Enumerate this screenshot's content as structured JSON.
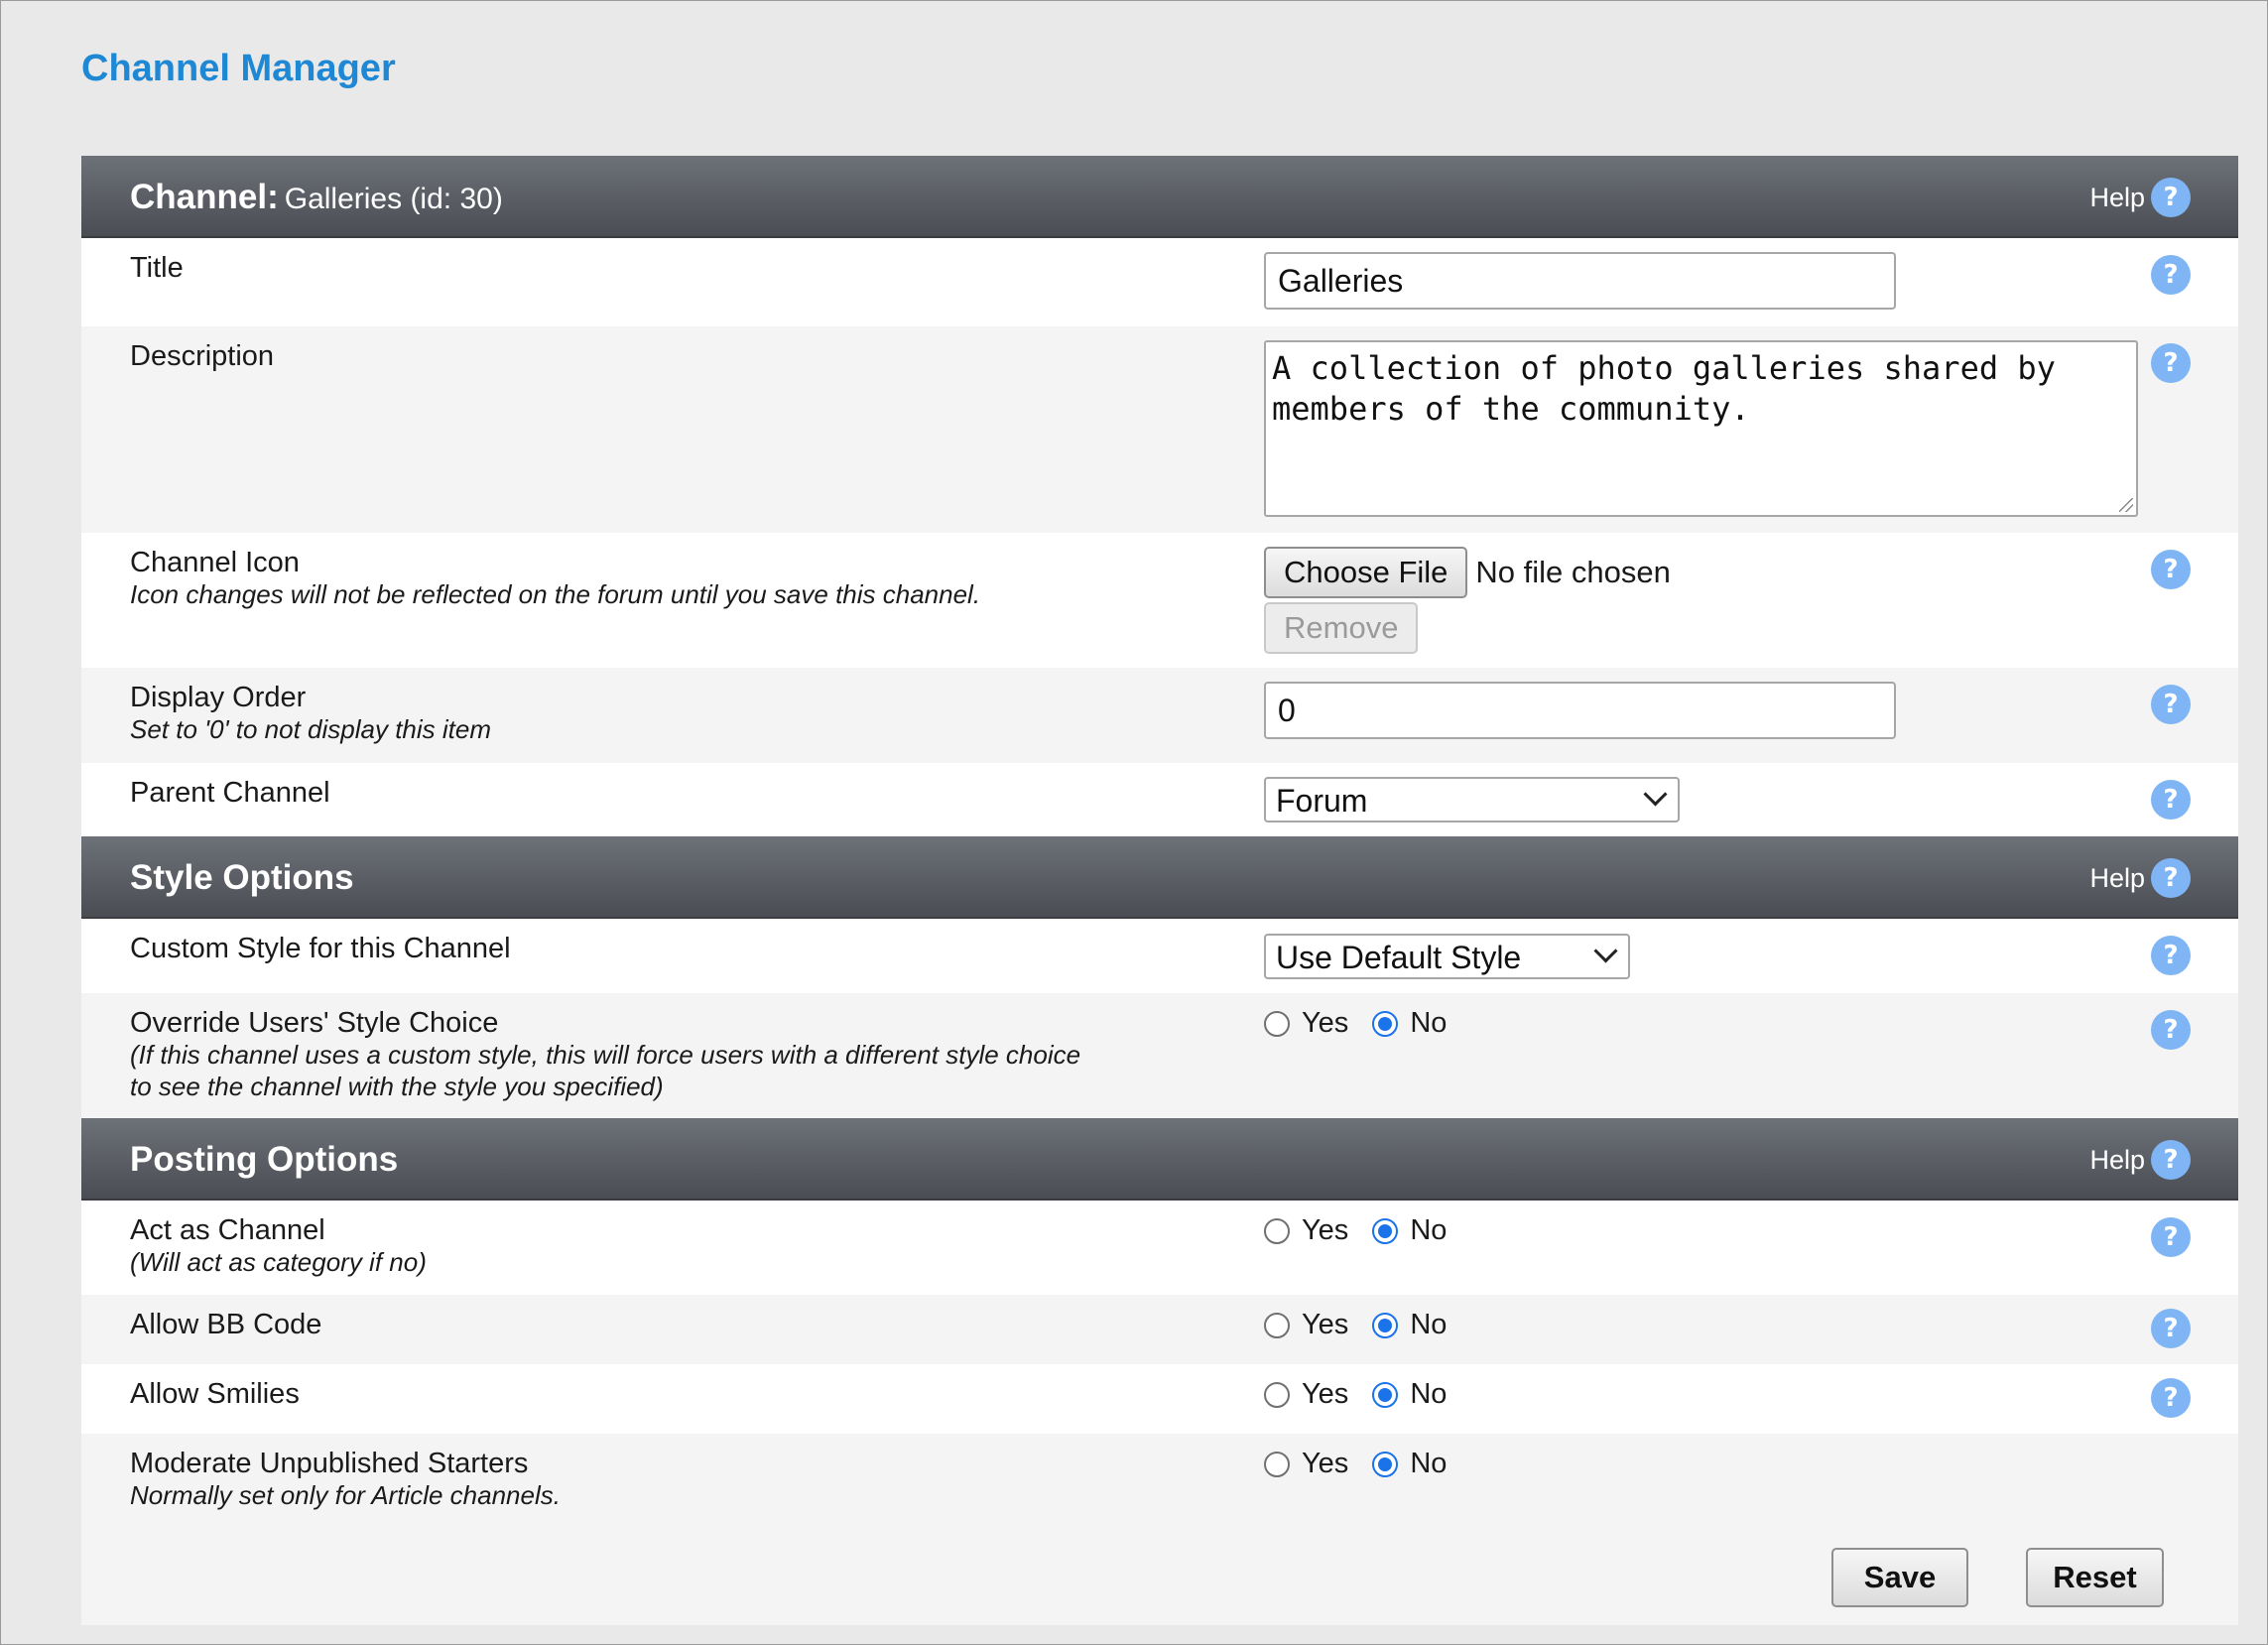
{
  "page_title": "Channel Manager",
  "sections": {
    "channel": {
      "title": "Channel:",
      "subtitle": "Galleries (id: 30)",
      "help": "Help",
      "title_field": {
        "label": "Title",
        "value": "Galleries"
      },
      "description_field": {
        "label": "Description",
        "value": "A collection of photo galleries shared by members of the community."
      },
      "icon_field": {
        "label": "Channel Icon",
        "note": "Icon changes will not be reflected on the forum until you save this channel.",
        "choose_button": "Choose File",
        "file_status": "No file chosen",
        "remove_button": "Remove"
      },
      "display_order_field": {
        "label": "Display Order",
        "note": "Set to '0' to not display this item",
        "value": "0"
      },
      "parent_field": {
        "label": "Parent Channel",
        "selected": "Forum"
      }
    },
    "style": {
      "title": "Style Options",
      "help": "Help",
      "custom_style": {
        "label": "Custom Style for this Channel",
        "selected": "Use Default Style"
      },
      "override": {
        "label": "Override Users' Style Choice",
        "note_line1": "(If this channel uses a custom style, this will force users with a different style choice",
        "note_line2": "to see the channel with the style you specified)",
        "value": "No"
      }
    },
    "posting": {
      "title": "Posting Options",
      "help": "Help",
      "act_as_channel": {
        "label": "Act as Channel",
        "note": "(Will act as category if no)",
        "value": "No"
      },
      "allow_bbcode": {
        "label": "Allow BB Code",
        "value": "No"
      },
      "allow_smilies": {
        "label": "Allow Smilies",
        "value": "No"
      },
      "moderate": {
        "label": "Moderate Unpublished Starters",
        "note": "Normally set only for Article channels.",
        "value": "No"
      }
    }
  },
  "radio_labels": {
    "yes": "Yes",
    "no": "No"
  },
  "footer": {
    "save": "Save",
    "reset": "Reset"
  },
  "colors": {
    "title_blue": "#1e88d4",
    "help_icon": "#7fb5f5",
    "radio_selected": "#1a73e8"
  }
}
